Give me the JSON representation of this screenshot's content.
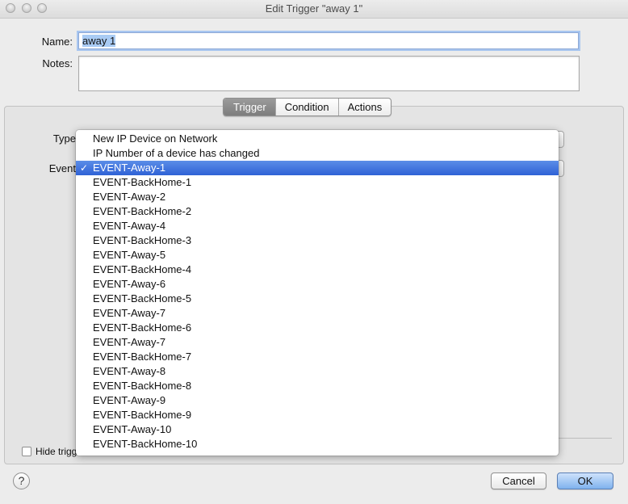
{
  "window": {
    "title": "Edit Trigger \"away 1\""
  },
  "form": {
    "name_label": "Name:",
    "name_value": "away 1",
    "notes_label": "Notes:",
    "notes_value": "",
    "type_label": "Type",
    "event_label": "Event"
  },
  "tabs": [
    {
      "label": "Trigger",
      "active": true
    },
    {
      "label": "Condition",
      "active": false
    },
    {
      "label": "Actions",
      "active": false
    }
  ],
  "menu": {
    "selected_index": 2,
    "checkmark": "✓",
    "items": [
      "New IP Device on Network",
      "IP Number of a device has changed",
      "EVENT-Away-1",
      "EVENT-BackHome-1",
      "EVENT-Away-2",
      "EVENT-BackHome-2",
      "EVENT-Away-4",
      "EVENT-BackHome-3",
      "EVENT-Away-5",
      "EVENT-BackHome-4",
      "EVENT-Away-6",
      "EVENT-BackHome-5",
      "EVENT-Away-7",
      "EVENT-BackHome-6",
      "EVENT-Away-7",
      "EVENT-BackHome-7",
      "EVENT-Away-8",
      "EVENT-BackHome-8",
      "EVENT-Away-9",
      "EVENT-BackHome-9",
      "EVENT-Away-10",
      "EVENT-BackHome-10"
    ]
  },
  "footer": {
    "hide_label": "Hide trigg",
    "help_label": "?",
    "cancel_label": "Cancel",
    "ok_label": "OK"
  },
  "colors": {
    "highlight": "#3a6fdc",
    "focus_ring": "#a8c6f0"
  }
}
